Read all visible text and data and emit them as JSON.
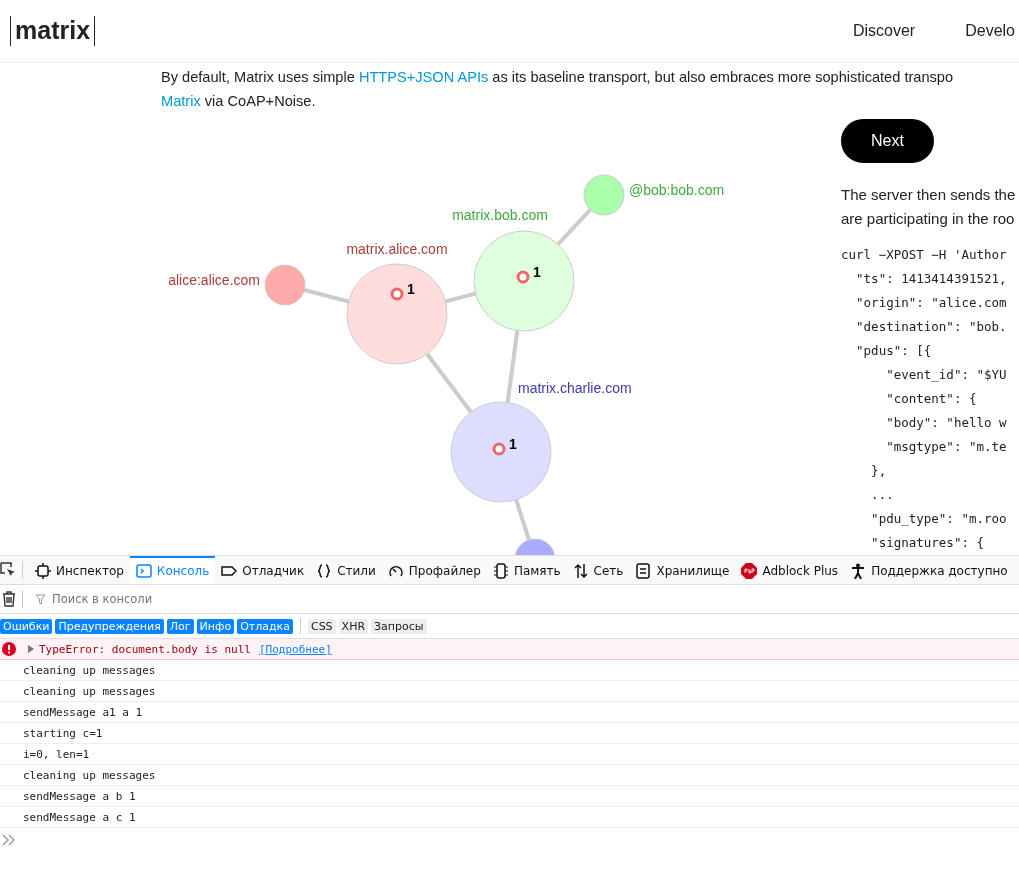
{
  "header": {
    "logo": "matrix",
    "nav": [
      "Discover",
      "Develo"
    ]
  },
  "intro": [
    [
      {
        "text": "By default, Matrix uses simple ",
        "link": false
      },
      {
        "text": "HTTPS+JSON APIs",
        "link": true
      },
      {
        "text": " as its baseline transport, but also embraces more sophisticated transpo",
        "link": false
      }
    ],
    [
      {
        "text": "Matrix",
        "link": true
      },
      {
        "text": " via CoAP+Noise.",
        "link": false
      }
    ]
  ],
  "diagram": {
    "nodes": [
      {
        "kind": "user",
        "label": "alice:alice.com",
        "color": "#ffaaaa"
      },
      {
        "kind": "server",
        "label": "matrix.alice.com",
        "color": "#ffdddd",
        "count": "1"
      },
      {
        "kind": "server",
        "label": "matrix.bob.com",
        "color": "#ddffdd",
        "count": "1"
      },
      {
        "kind": "user",
        "label": "@bob:bob.com",
        "color": "#aaffaa"
      },
      {
        "kind": "server",
        "label": "matrix.charlie.com",
        "color": "#ddddff",
        "count": "1"
      },
      {
        "kind": "user",
        "color": "#aaaaff"
      }
    ]
  },
  "side": {
    "button": "Next",
    "text": [
      "The server then sends the",
      "are participating in the roo"
    ],
    "code": [
      "curl −XPOST −H 'Author",
      "  \"ts\": 1413414391521,",
      "  \"origin\": \"alice.com",
      "  \"destination\": \"bob.",
      "  \"pdus\": [{",
      "      \"event_id\": \"$YU",
      "      \"content\": {",
      "      \"body\": \"hello w",
      "      \"msgtype\": \"m.te",
      "    },",
      "    ...",
      "    \"pdu_type\": \"m.roo",
      "    \"signatures\": {"
    ]
  },
  "devtools": {
    "tabs": [
      {
        "label": "Инспектор",
        "selected": false
      },
      {
        "label": "Консоль",
        "selected": true
      },
      {
        "label": "Отладчик",
        "selected": false
      },
      {
        "label": "Стили",
        "selected": false
      },
      {
        "label": "Профайлер",
        "selected": false
      },
      {
        "label": "Память",
        "selected": false
      },
      {
        "label": "Сеть",
        "selected": false
      },
      {
        "label": "Хранилище",
        "selected": false
      },
      {
        "label": "Adblock Plus",
        "selected": false
      },
      {
        "label": "Поддержка доступно",
        "selected": false
      }
    ],
    "search": {
      "placeholder": "Поиск в консоли"
    },
    "filters": [
      {
        "label": "Ошибки",
        "selected": true
      },
      {
        "label": "Предупреждения",
        "selected": true
      },
      {
        "label": "Лог",
        "selected": true
      },
      {
        "label": "Инфо",
        "selected": true
      },
      {
        "label": "Отладка",
        "selected": true
      },
      {
        "label": "CSS",
        "selected": false
      },
      {
        "label": "XHR",
        "selected": false
      },
      {
        "label": "Запросы",
        "selected": false
      }
    ],
    "messages": [
      {
        "kind": "error",
        "text": "TypeError: document.body is null",
        "link": "[Подробнее]"
      },
      {
        "kind": "log",
        "text": "cleaning up messages"
      },
      {
        "kind": "log",
        "text": "cleaning up messages"
      },
      {
        "kind": "log",
        "text": "sendMessage a1 a 1"
      },
      {
        "kind": "log",
        "text": "starting c=1"
      },
      {
        "kind": "log",
        "text": "i=0, len=1"
      },
      {
        "kind": "log",
        "text": "cleaning up messages"
      },
      {
        "kind": "log",
        "text": "sendMessage a b 1"
      },
      {
        "kind": "log",
        "text": "sendMessage a c 1"
      }
    ]
  }
}
